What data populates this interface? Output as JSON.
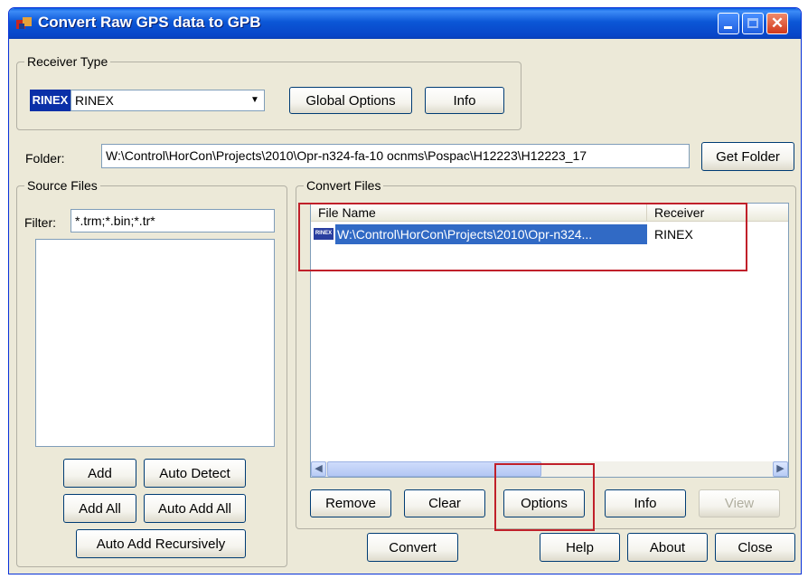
{
  "window": {
    "title": "Convert Raw GPS data to GPB"
  },
  "receiver_type": {
    "label": "Receiver Type",
    "badge": "RINEX",
    "selected": "RINEX",
    "global_options": "Global Options",
    "info": "Info"
  },
  "folder": {
    "label": "Folder:",
    "value": "W:\\Control\\HorCon\\Projects\\2010\\Opr-n324-fa-10 ocnms\\Pospac\\H12223\\H12223_17",
    "get_folder": "Get Folder"
  },
  "source_files": {
    "label": "Source Files",
    "filter_label": "Filter:",
    "filter_value": "*.trm;*.bin;*.tr*",
    "buttons": {
      "add": "Add",
      "auto_detect": "Auto Detect",
      "add_all": "Add All",
      "auto_add_all": "Auto Add All",
      "auto_add_recursively": "Auto Add Recursively"
    }
  },
  "convert_files": {
    "label": "Convert Files",
    "columns": [
      "File Name",
      "Receiver"
    ],
    "rows": [
      {
        "badge": "RINEX",
        "file": "W:\\Control\\HorCon\\Projects\\2010\\Opr-n324...",
        "receiver": "RINEX"
      }
    ],
    "buttons": {
      "remove": "Remove",
      "clear": "Clear",
      "options": "Options",
      "info": "Info",
      "view": "View"
    }
  },
  "footer": {
    "convert": "Convert",
    "help": "Help",
    "about": "About",
    "close": "Close"
  },
  "colors": {
    "selection": "#316ac5",
    "highlight_box": "#c0202a",
    "titlebar": "#0b56d6"
  }
}
